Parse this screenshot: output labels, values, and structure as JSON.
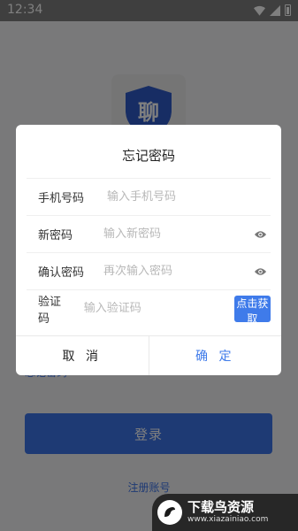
{
  "status_bar": {
    "time": "12:34"
  },
  "background": {
    "logo_char": "聊",
    "forgot_link": "忘记密码",
    "login_label": "登录",
    "register_link": "注册账号"
  },
  "dialog": {
    "title": "忘记密码",
    "fields": [
      {
        "label": "手机号码",
        "placeholder": "输入手机号码"
      },
      {
        "label": "新密码",
        "placeholder": "输入新密码"
      },
      {
        "label": "确认密码",
        "placeholder": "再次输入密码"
      },
      {
        "label": "验证码",
        "placeholder": "输入验证码"
      }
    ],
    "get_code_label": "点击获取",
    "cancel_label": "取 消",
    "confirm_label": "确 定"
  },
  "watermark": {
    "title": "下载鸟资源",
    "url": "www.xiazainiao.com"
  },
  "colors": {
    "accent": "#3f7bea",
    "overlay": "rgba(0,0,0,0.5)"
  },
  "icons": [
    "wifi-icon",
    "signal-icon",
    "battery-icon",
    "eye-icon",
    "shield-logo-icon"
  ]
}
